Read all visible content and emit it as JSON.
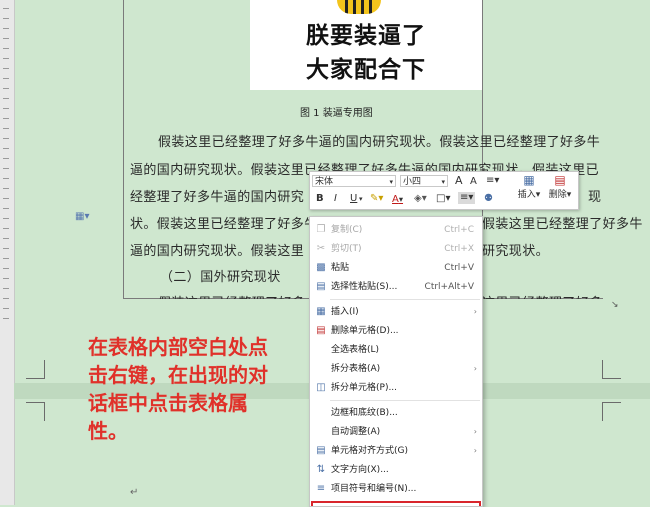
{
  "document": {
    "image_line1": "朕要装逼了",
    "image_line2": "大家配合下",
    "caption": "图 1 装逼专用图",
    "body_lines": [
      "假装这里已经整理了好多牛逼的国内研究现状。假装这里已经整理了好多牛",
      "逼的国内研究现状。假装这里已经整理了好多牛逼的国内研究现状。假装这里已",
      "经整理了好多牛逼的国内研究",
      "状。假装这里已经整理了好多牛逼的国内研究",
      "逼的国内研究现状。假装这里",
      "（二）国外研究现状",
      "假装这里已经整理了好多"
    ],
    "fragment_right_1": "现",
    "fragment_right_2": "假装这里已经整理了好多牛",
    "fragment_right_3": "研究现状。",
    "fragment_right_4": "这里已经整理了好多",
    "instruction": "在表格内部空白处点击右键，在出现的对话框中点击表格属性。"
  },
  "mini_toolbar": {
    "font_name": "宋体",
    "font_size": "小四",
    "grow_font": "A",
    "shrink_font": "A",
    "bold": "B",
    "italic": "I",
    "underline": "U",
    "insert_label": "插入",
    "delete_label": "删除"
  },
  "context_menu": {
    "items": [
      {
        "label": "复制(C)",
        "shortcut": "Ctrl+C",
        "icon": "copy-icon",
        "enabled": false
      },
      {
        "label": "剪切(T)",
        "shortcut": "Ctrl+X",
        "icon": "scissors-icon",
        "enabled": false
      },
      {
        "label": "粘贴",
        "shortcut": "Ctrl+V",
        "icon": "paste-icon",
        "enabled": true
      },
      {
        "label": "选择性粘贴(S)...",
        "shortcut": "Ctrl+Alt+V",
        "icon": "paste-special-icon",
        "enabled": true
      },
      {
        "label": "插入(I)",
        "shortcut": "",
        "icon": "insert-table-icon",
        "enabled": true,
        "submenu": true
      },
      {
        "label": "删除单元格(D)...",
        "shortcut": "",
        "icon": "delete-cell-icon",
        "enabled": true
      },
      {
        "label": "全选表格(L)",
        "shortcut": "",
        "icon": "",
        "enabled": true
      },
      {
        "label": "拆分表格(A)",
        "shortcut": "",
        "icon": "",
        "enabled": true,
        "submenu": true
      },
      {
        "label": "拆分单元格(P)...",
        "shortcut": "",
        "icon": "split-cell-icon",
        "enabled": true
      },
      {
        "label": "边框和底纹(B)...",
        "shortcut": "",
        "icon": "",
        "enabled": true
      },
      {
        "label": "自动调整(A)",
        "shortcut": "",
        "icon": "",
        "enabled": true,
        "submenu": true
      },
      {
        "label": "单元格对齐方式(G)",
        "shortcut": "",
        "icon": "cell-align-icon",
        "enabled": true,
        "submenu": true
      },
      {
        "label": "文字方向(X)...",
        "shortcut": "",
        "icon": "text-direction-icon",
        "enabled": true
      },
      {
        "label": "项目符号和编号(N)...",
        "shortcut": "",
        "icon": "bullets-icon",
        "enabled": true
      }
    ]
  },
  "colors": {
    "page_bg": "#cfe7cf",
    "instruction_text": "#e0312a",
    "highlight_border": "#d9262c"
  }
}
